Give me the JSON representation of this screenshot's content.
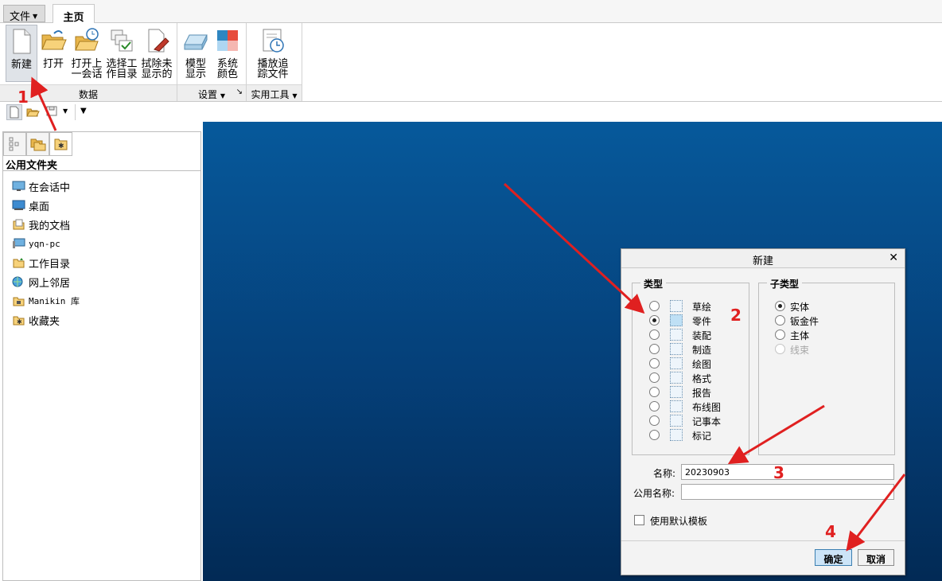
{
  "tabs": {
    "file": "文件",
    "home": "主页"
  },
  "ribbon": {
    "buttons": [
      {
        "label": "新建",
        "icon": "new-file-icon"
      },
      {
        "label": "打开",
        "icon": "open-folder-icon"
      },
      {
        "label": "打开上一会话",
        "line1": "打开上",
        "line2": "一会话",
        "icon": "open-session-icon"
      },
      {
        "label": "选择工作目录",
        "line1": "选择工",
        "line2": "作目录",
        "icon": "working-directory-icon"
      },
      {
        "label": "拭除未显示的",
        "line1": "拭除未",
        "line2": "显示的",
        "icon": "erase-icon"
      },
      {
        "label": "模型显示",
        "line1": "模型",
        "line2": "显示",
        "icon": "model-display-icon"
      },
      {
        "label": "系统颜色",
        "line1": "系统",
        "line2": "颜色",
        "icon": "system-colors-icon"
      },
      {
        "label": "播放追踪文件",
        "line1": "播放追",
        "line2": "踪文件",
        "icon": "play-trail-icon"
      }
    ],
    "groups": {
      "data": "数据",
      "settings": "设置",
      "utilities": "实用工具"
    }
  },
  "panel": {
    "title": "公用文件夹",
    "folders": [
      {
        "label": "在会话中",
        "icon": "monitor-icon"
      },
      {
        "label": "桌面",
        "icon": "desktop-icon"
      },
      {
        "label": "我的文档",
        "icon": "documents-icon"
      },
      {
        "label": "yqn-pc",
        "icon": "computer-icon"
      },
      {
        "label": "工作目录",
        "icon": "working-folder-icon"
      },
      {
        "label": "网上邻居",
        "icon": "network-icon"
      },
      {
        "label": "Manikin 库",
        "icon": "library-icon"
      },
      {
        "label": "收藏夹",
        "icon": "favorites-icon"
      }
    ]
  },
  "dialog": {
    "title": "新建",
    "type_legend": "类型",
    "subtype_legend": "子类型",
    "types": [
      "草绘",
      "零件",
      "装配",
      "制造",
      "绘图",
      "格式",
      "报告",
      "布线图",
      "记事本",
      "标记"
    ],
    "selected_type": "零件",
    "subtypes": [
      "实体",
      "钣金件",
      "主体",
      "线束"
    ],
    "selected_subtype": "实体",
    "name_label": "名称:",
    "name_value": "20230903",
    "common_name_label": "公用名称:",
    "common_name_value": "",
    "template_checkbox": "使用默认模板",
    "ok": "确定",
    "cancel": "取消"
  },
  "annotations": {
    "step1": "1",
    "step2": "2",
    "step3": "3",
    "step4": "4",
    "color": "#e02020"
  },
  "colors": {
    "graphics_top": "#06599b",
    "graphics_bottom": "#022a55"
  }
}
